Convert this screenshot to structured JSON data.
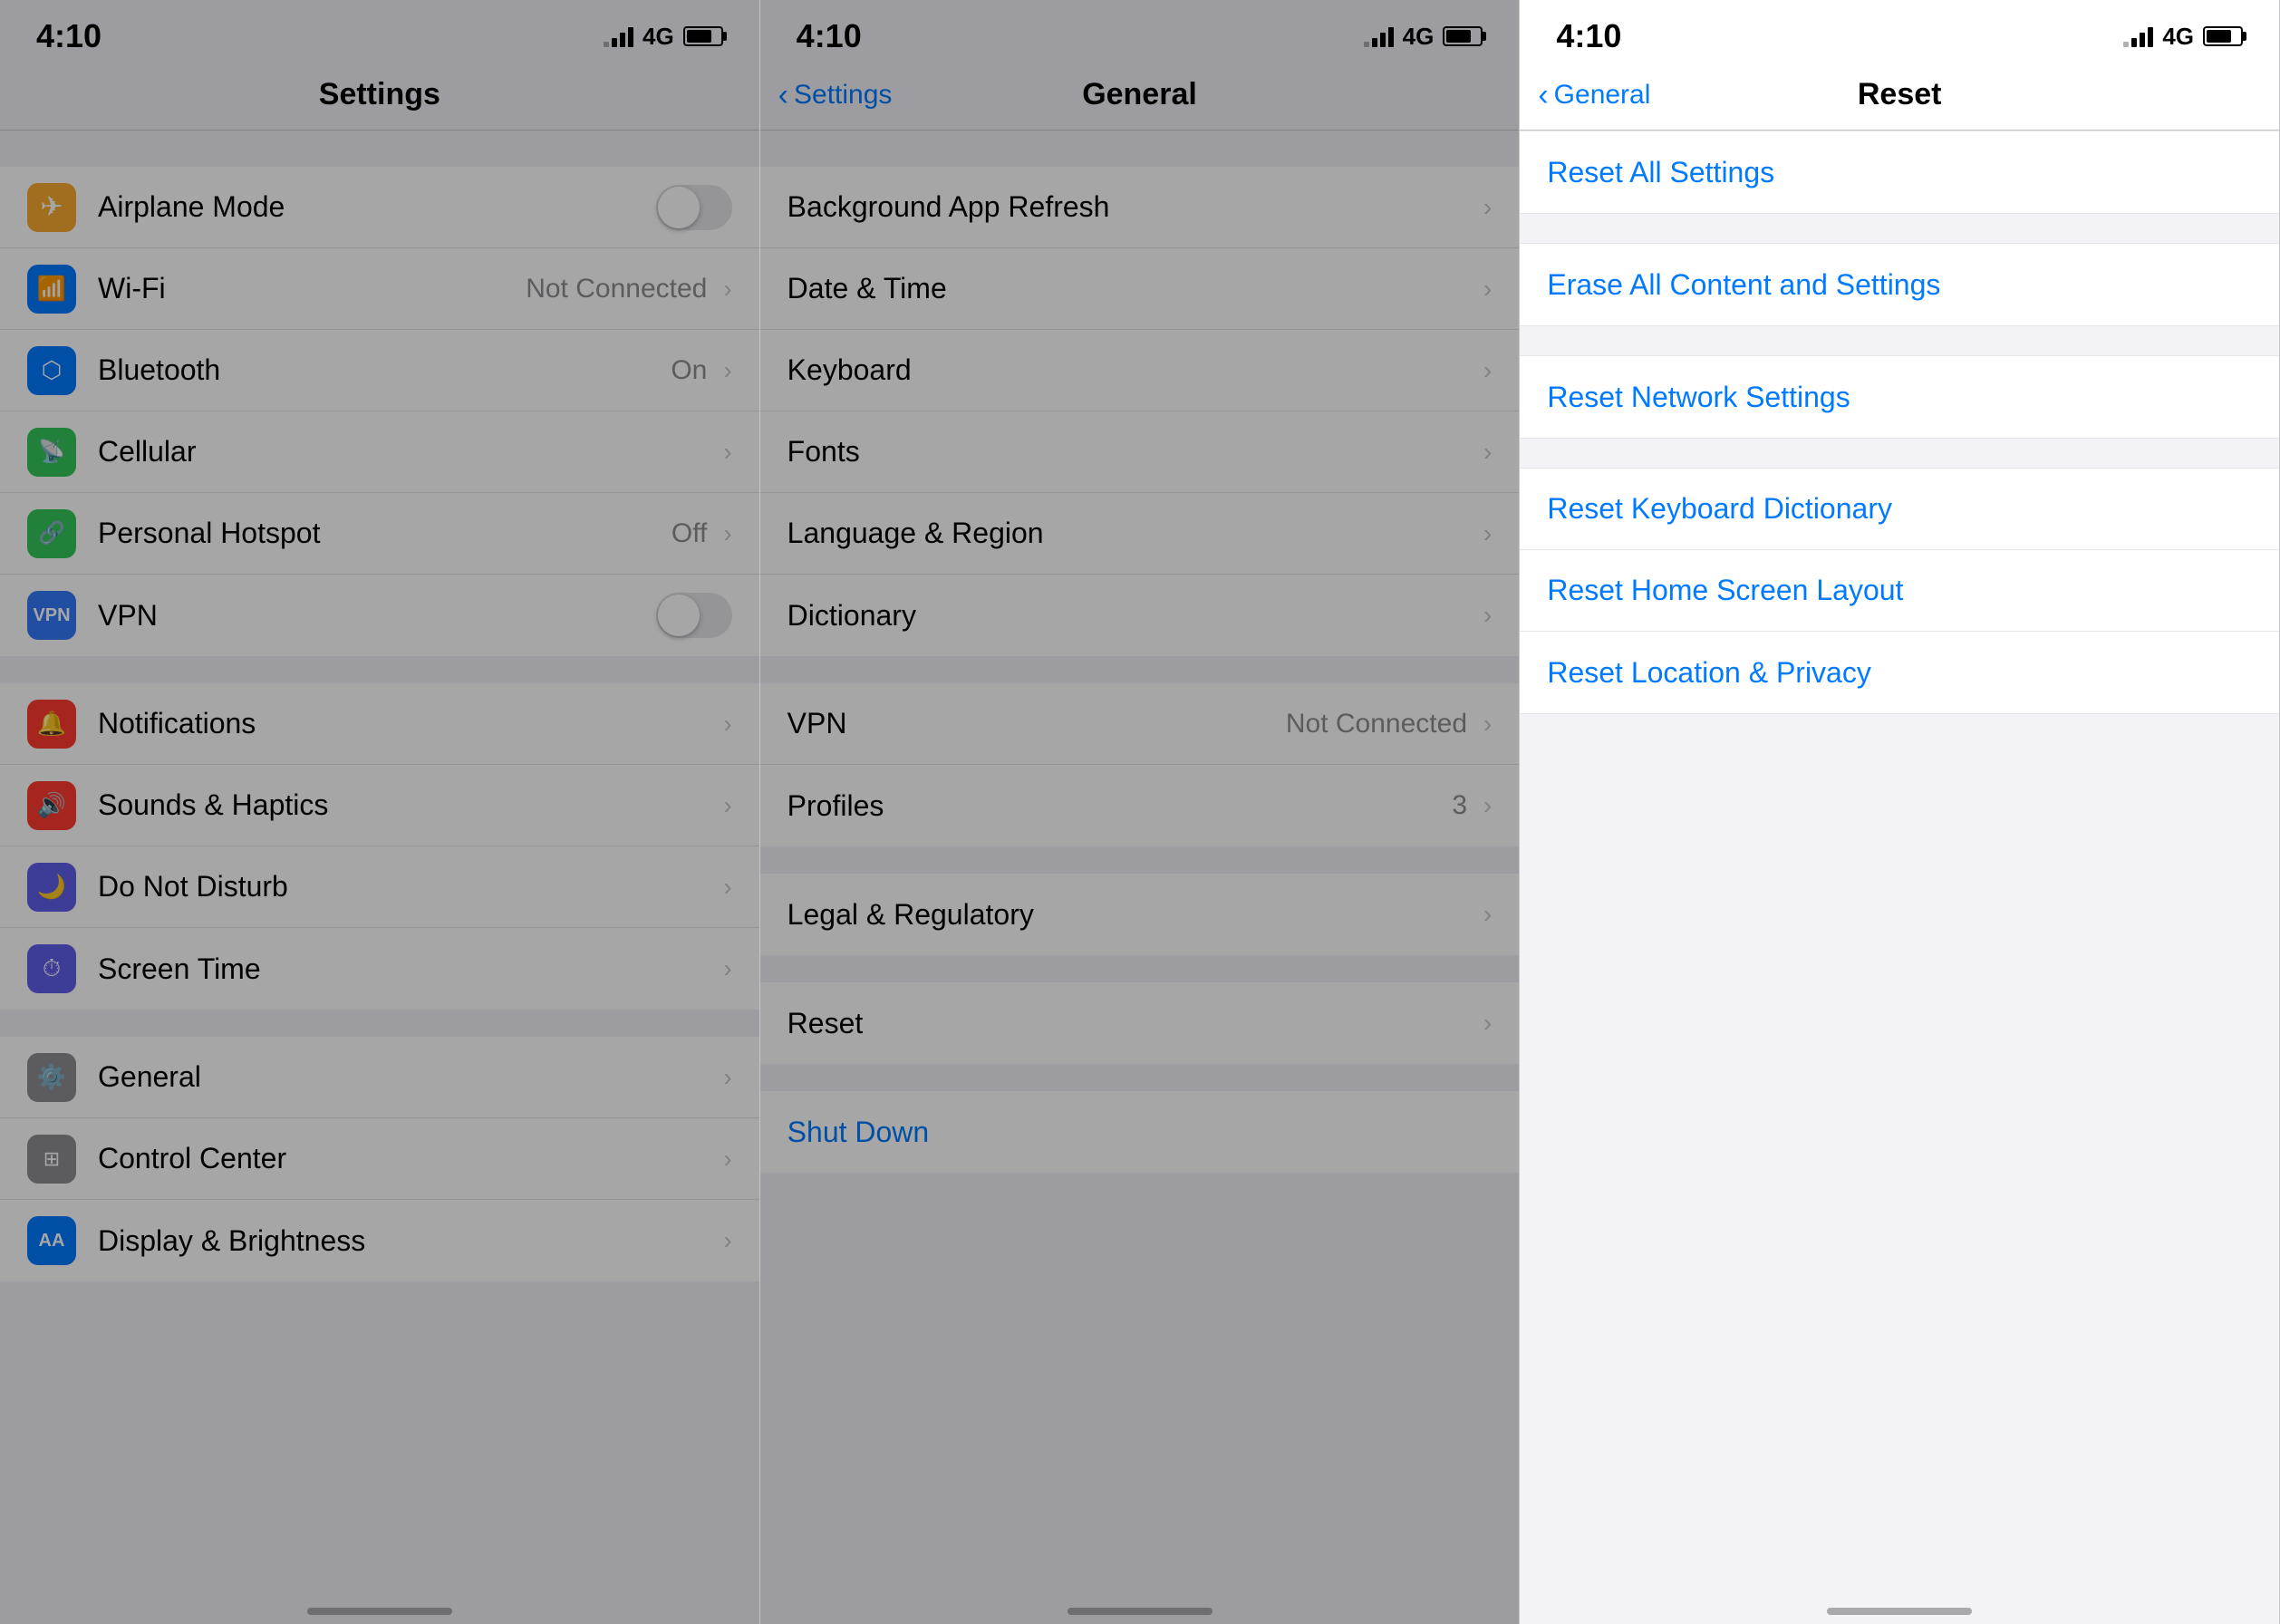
{
  "screens": [
    {
      "id": "settings",
      "status": {
        "time": "4:10",
        "network": "4G"
      },
      "nav": {
        "title": "Settings",
        "back": null
      },
      "sections": [
        {
          "id": "connectivity",
          "rows": [
            {
              "id": "airplane",
              "icon": "✈",
              "icon_bg": "#f7a830",
              "label": "Airplane Mode",
              "value": "",
              "type": "toggle",
              "toggle_on": false,
              "chevron": false
            },
            {
              "id": "wifi",
              "icon": "📶",
              "icon_bg": "#007aff",
              "label": "Wi-Fi",
              "value": "Not Connected",
              "type": "nav",
              "chevron": true
            },
            {
              "id": "bluetooth",
              "icon": "🔷",
              "icon_bg": "#007aff",
              "label": "Bluetooth",
              "value": "On",
              "type": "nav",
              "chevron": true
            },
            {
              "id": "cellular",
              "icon": "📡",
              "icon_bg": "#34c759",
              "label": "Cellular",
              "value": "",
              "type": "nav",
              "chevron": true
            },
            {
              "id": "hotspot",
              "icon": "🔗",
              "icon_bg": "#34c759",
              "label": "Personal Hotspot",
              "value": "Off",
              "type": "nav",
              "chevron": true
            },
            {
              "id": "vpn",
              "icon": "VPN",
              "icon_bg": "#3478f6",
              "label": "VPN",
              "value": "",
              "type": "toggle",
              "toggle_on": false,
              "chevron": false
            }
          ]
        },
        {
          "id": "notifications",
          "rows": [
            {
              "id": "notifications",
              "icon": "🔔",
              "icon_bg": "#ff3b30",
              "label": "Notifications",
              "value": "",
              "type": "nav",
              "chevron": true
            },
            {
              "id": "sounds",
              "icon": "🔊",
              "icon_bg": "#ff3b30",
              "label": "Sounds & Haptics",
              "value": "",
              "type": "nav",
              "chevron": true
            },
            {
              "id": "dnd",
              "icon": "🌙",
              "icon_bg": "#5e5ce6",
              "label": "Do Not Disturb",
              "value": "",
              "type": "nav",
              "chevron": true
            },
            {
              "id": "screentime",
              "icon": "⏱",
              "icon_bg": "#5e5ce6",
              "label": "Screen Time",
              "value": "",
              "type": "nav",
              "chevron": true
            }
          ]
        },
        {
          "id": "general-section",
          "rows": [
            {
              "id": "general",
              "icon": "⚙",
              "icon_bg": "#8e8e93",
              "label": "General",
              "value": "",
              "type": "nav",
              "chevron": true,
              "active": true
            },
            {
              "id": "control-center",
              "icon": "⊞",
              "icon_bg": "#8e8e93",
              "label": "Control Center",
              "value": "",
              "type": "nav",
              "chevron": true
            },
            {
              "id": "display",
              "icon": "AA",
              "icon_bg": "#007aff",
              "label": "Display & Brightness",
              "value": "",
              "type": "nav",
              "chevron": true
            }
          ]
        }
      ],
      "dimmed": true
    },
    {
      "id": "general",
      "status": {
        "time": "4:10",
        "network": "4G"
      },
      "nav": {
        "title": "General",
        "back": "Settings"
      },
      "sections": [
        {
          "id": "general-top",
          "rows": [
            {
              "id": "bg-refresh",
              "label": "Background App Refresh",
              "value": "",
              "type": "nav",
              "chevron": true
            },
            {
              "id": "datetime",
              "label": "Date & Time",
              "value": "",
              "type": "nav",
              "chevron": true
            },
            {
              "id": "keyboard",
              "label": "Keyboard",
              "value": "",
              "type": "nav",
              "chevron": true
            },
            {
              "id": "fonts",
              "label": "Fonts",
              "value": "",
              "type": "nav",
              "chevron": true
            },
            {
              "id": "language",
              "label": "Language & Region",
              "value": "",
              "type": "nav",
              "chevron": true
            },
            {
              "id": "dictionary",
              "label": "Dictionary",
              "value": "",
              "type": "nav",
              "chevron": true
            }
          ]
        },
        {
          "id": "general-mid",
          "rows": [
            {
              "id": "vpn-general",
              "label": "VPN",
              "value": "Not Connected",
              "type": "nav",
              "chevron": true
            },
            {
              "id": "profiles",
              "label": "Profiles",
              "value": "3",
              "type": "nav",
              "chevron": true
            }
          ]
        },
        {
          "id": "general-legal",
          "rows": [
            {
              "id": "legal",
              "label": "Legal & Regulatory",
              "value": "",
              "type": "nav",
              "chevron": true
            }
          ]
        },
        {
          "id": "general-reset",
          "rows": [
            {
              "id": "reset",
              "label": "Reset",
              "value": "",
              "type": "nav",
              "chevron": true
            }
          ]
        },
        {
          "id": "general-shutdown",
          "rows": [
            {
              "id": "shutdown",
              "label": "Shut Down",
              "value": "",
              "type": "blue",
              "chevron": false
            }
          ]
        }
      ],
      "dimmed": true
    },
    {
      "id": "reset",
      "status": {
        "time": "4:10",
        "network": "4G"
      },
      "nav": {
        "title": "Reset",
        "back": "General"
      },
      "rows": [
        {
          "id": "reset-all",
          "label": "Reset All Settings",
          "blue": true
        },
        {
          "id": "erase-all",
          "label": "Erase All Content and Settings",
          "blue": true
        },
        {
          "id": "reset-network",
          "label": "Reset Network Settings",
          "blue": true
        },
        {
          "id": "reset-keyboard",
          "label": "Reset Keyboard Dictionary",
          "blue": true
        },
        {
          "id": "reset-home",
          "label": "Reset Home Screen Layout",
          "blue": true
        },
        {
          "id": "reset-location",
          "label": "Reset Location & Privacy",
          "blue": true
        }
      ],
      "dimmed": false
    }
  ],
  "icons": {
    "airplane": "✈",
    "wifi": "wifi",
    "bluetooth": "bluetooth",
    "cellular": "cellular",
    "hotspot": "hotspot",
    "vpn_label": "VPN",
    "notifications": "notifications",
    "sounds": "sounds",
    "dnd": "moon",
    "screentime": "hourglass",
    "general": "gear",
    "control_center": "grid",
    "display": "display"
  },
  "colors": {
    "airplane_bg": "#f7a830",
    "wifi_bg": "#007aff",
    "bluetooth_bg": "#007aff",
    "cellular_bg": "#34c759",
    "hotspot_bg": "#34c759",
    "vpn_bg": "#3478f6",
    "notifications_bg": "#ff3b30",
    "sounds_bg": "#ff3b30",
    "dnd_bg": "#5e5ce6",
    "screentime_bg": "#5e5ce6",
    "general_bg": "#8e8e93",
    "control_bg": "#8e8e93",
    "display_bg": "#007aff",
    "blue": "#007aff"
  }
}
